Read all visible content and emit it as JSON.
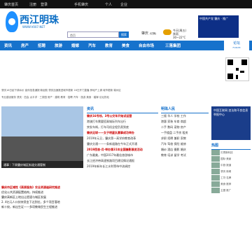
{
  "topbar": {
    "links": [
      "肇庆首页",
      "注册",
      "登录",
      "手机肇庆",
      "个人",
      "企业"
    ]
  },
  "header": {
    "logo_title": "西江明珠",
    "logo_url": "WWW.V007.NET",
    "search_select": "首页",
    "search_button": "搜索",
    "city": "肇庆",
    "city_sub": "(切换)",
    "weather_lines": [
      "今天(周五)",
      "阵雨",
      "30~22°C"
    ],
    "ad_text": "中国共产党 肇庆 · 推广"
  },
  "nav": {
    "items": [
      "资讯",
      "房产",
      "招聘",
      "旅游",
      "婚嫁",
      "汽车",
      "教育",
      "美食",
      "自由市场",
      "三落集团"
    ],
    "bbs_label": "论坛",
    "bbs_sub": "FORUM"
  },
  "sublinks": [
    "肇庆16日起下调水价  宣传信息通报·新起航  肇庆加速推进城市更新  16日开门直播  房地产上调  城市更新  端州区",
    "专业建设服务  肇庆 · 四会  太平洋 · 三茶园  房产 · 建筑  教育 · 招聘  汽车 · 旅游  美食 · 婚嫁  论坛热帖"
  ],
  "slide_caption": "通事｜下周肇庆城区街道交通管制",
  "hot": {
    "title": "肇庆市区域性《高原服务》农业资源遍研究推进",
    "lines": [
      "优化公共资源配置结构，持续推进",
      "肇庆高新区土地出让提速与城区发展",
      "2. 4亿元人口扶持资金下达到位，多个项目落地",
      "新十校，新出生证——多项教育民生工程推进"
    ]
  },
  "news": {
    "section": "资讯",
    "items": [
      "肇庆16号线，3号公交车开始试运营",
      "港澳打车需要搭乘城际列车出行",
      "突发车祸，打车司机全程负责到底",
      "肇庆足球——女子明星队赛事成功举办",
      "2019年元旦，肇庆第一高学府教育改革",
      "肇庆交通——一条新道路在今年正式开通",
      "2019西舍·月·举办第31年全国摄影展览活动",
      "广东最美，中国2017年最佳旅游城市",
      "长江经济带高速铁路项目建设情况通报",
      "2019年新年长江水利等待中流调控"
    ]
  },
  "life": {
    "section": "明珠人民",
    "rows": [
      "三楼  华人  学校  工作",
      "港惠  家装  车商  商超",
      "二手  数码  宠物  房产",
      "一手楼盘  二手房  租房",
      "求职  招聘  兼职  家教",
      "汽车  驾校  保险  维修",
      "婚纱  酒店  摄影  婚庆",
      "教育  培训  留学  考试"
    ]
  },
  "side": {
    "ad_text": "中国互联网 违法和不良信息举报中心",
    "list_title": "热图",
    "list": [
      "贝恩斯科技",
      "国际·美景",
      "中旅·报道",
      "肇庆·新闻",
      "工坊·名牌",
      "美食·推荐",
      "主图·推广"
    ]
  }
}
